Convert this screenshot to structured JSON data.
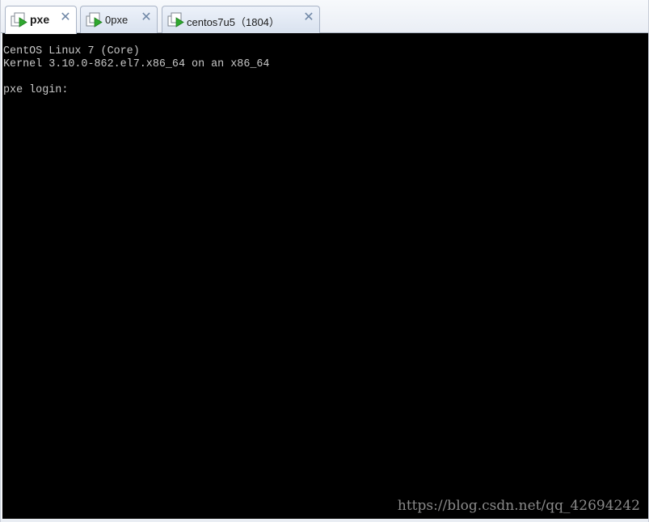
{
  "tabs": [
    {
      "label": "pxe",
      "active": true,
      "icon": "vm-play-icon",
      "close": "✕"
    },
    {
      "label": "0pxe",
      "active": false,
      "icon": "vm-play-icon",
      "close": "✕"
    },
    {
      "label": "centos7u5（1804）",
      "active": false,
      "icon": "vm-play-icon",
      "close": "✕"
    }
  ],
  "console": {
    "lines": [
      "CentOS Linux 7 (Core)",
      "Kernel 3.10.0-862.el7.x86_64 on an x86_64",
      "",
      "pxe login:"
    ],
    "background": "#000000",
    "text_color": "#c8c8c8"
  },
  "watermark": "https://blog.csdn.net/qq_42694242"
}
